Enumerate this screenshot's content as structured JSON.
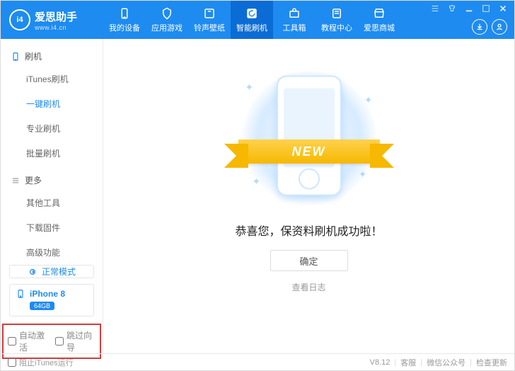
{
  "header": {
    "logo_badge": "i4",
    "brand_cn": "爱思助手",
    "brand_url": "www.i4.cn",
    "nav": [
      {
        "label": "我的设备"
      },
      {
        "label": "应用游戏"
      },
      {
        "label": "铃声壁纸"
      },
      {
        "label": "智能刷机"
      },
      {
        "label": "工具箱"
      },
      {
        "label": "教程中心"
      },
      {
        "label": "爱思商城"
      }
    ]
  },
  "sidebar": {
    "sections": [
      {
        "title": "刷机",
        "items": [
          {
            "label": "iTunes刷机"
          },
          {
            "label": "一键刷机"
          },
          {
            "label": "专业刷机"
          },
          {
            "label": "批量刷机"
          }
        ]
      },
      {
        "title": "更多",
        "items": [
          {
            "label": "其他工具"
          },
          {
            "label": "下载固件"
          },
          {
            "label": "高级功能"
          }
        ]
      }
    ],
    "mode_label": "正常模式",
    "device_name": "iPhone 8",
    "device_capacity": "64GB",
    "checkbox_auto_activate": "自动激活",
    "checkbox_skip_setup": "跳过向导"
  },
  "main": {
    "banner_text": "NEW",
    "success_message": "恭喜您，保资料刷机成功啦！",
    "confirm_label": "确定",
    "view_log_label": "查看日志"
  },
  "statusbar": {
    "prevent_itunes": "阻止iTunes运行",
    "version": "V8.12",
    "support": "客服",
    "wechat": "微信公众号",
    "check_update": "检查更新"
  }
}
